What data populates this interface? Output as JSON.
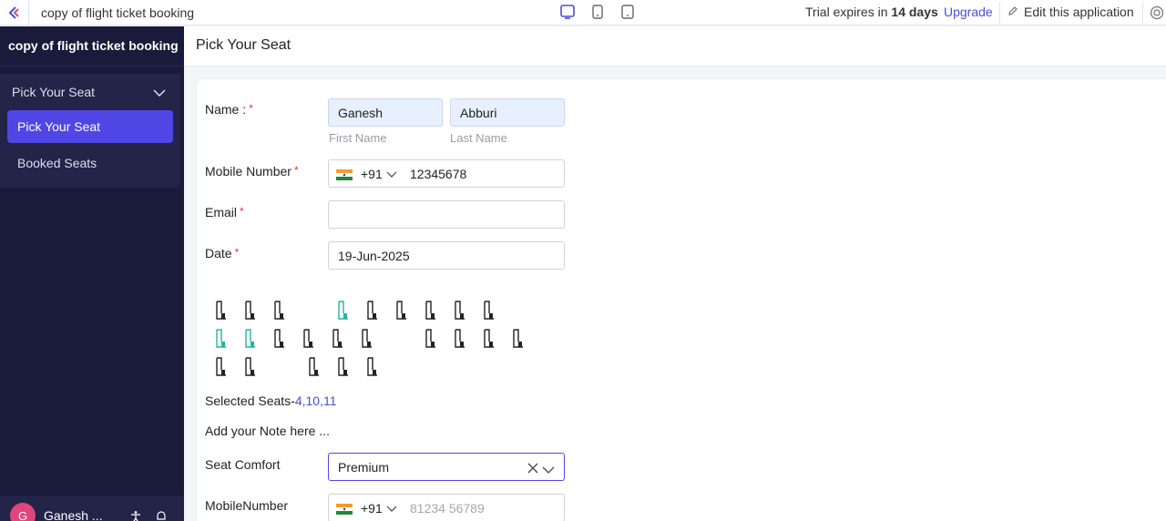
{
  "topbar": {
    "app_title": "copy of flight ticket booking",
    "trial_prefix": "Trial expires in ",
    "trial_days": "14 days",
    "upgrade": "Upgrade",
    "edit_app": "Edit this application"
  },
  "sidebar": {
    "brand": "copy of flight ticket booking",
    "group_label": "Pick Your Seat",
    "items": [
      {
        "label": "Pick Your Seat",
        "active": true
      },
      {
        "label": "Booked Seats",
        "active": false
      }
    ],
    "user": {
      "initial": "G",
      "name": "Ganesh ..."
    }
  },
  "page": {
    "title": "Pick Your Seat"
  },
  "form": {
    "name_label": "Name :",
    "first_name_value": "Ganesh",
    "last_name_value": "Abburi",
    "first_name_hint": "First Name",
    "last_name_hint": "Last Name",
    "mobile_label": "Mobile Number",
    "mobile_code": "+91",
    "mobile_value": "12345678",
    "email_label": "Email",
    "email_value": "",
    "date_label": "Date",
    "date_value": "19-Jun-2025",
    "required_mark": "*",
    "selected_seats_label": "Selected Seats-",
    "selected_seats_value": "4,10,11",
    "note_label": "Add your Note here ...",
    "seat_comfort_label": "Seat Comfort",
    "seat_comfort_value": "Premium",
    "mobile2_label": "MobileNumber",
    "mobile2_code": "+91",
    "mobile2_placeholder": "81234 56789"
  },
  "seat_map": {
    "rows": [
      [
        {
          "s": "a"
        },
        {
          "s": "a"
        },
        {
          "s": "a"
        },
        {
          "s": "gap"
        },
        {
          "s": "selected"
        },
        {
          "s": "a"
        },
        {
          "s": "a"
        },
        {
          "s": "a"
        },
        {
          "s": "a"
        },
        {
          "s": "a"
        }
      ],
      [
        {
          "s": "selected"
        },
        {
          "s": "selected"
        },
        {
          "s": "a"
        },
        {
          "s": "a"
        },
        {
          "s": "a"
        },
        {
          "s": "a"
        },
        {
          "s": "gap"
        },
        {
          "s": "a"
        },
        {
          "s": "a"
        },
        {
          "s": "a"
        },
        {
          "s": "a"
        }
      ],
      [
        {
          "s": "a"
        },
        {
          "s": "a"
        },
        {
          "s": "gap"
        },
        {
          "s": "a"
        },
        {
          "s": "a"
        },
        {
          "s": "a"
        }
      ]
    ],
    "colors": {
      "available": "#222222",
      "selected": "#26b3a0"
    }
  },
  "colors": {
    "accent": "#5046e5",
    "sidebar_bg": "#1a1a3a",
    "link": "#4a4fd8",
    "required": "#e53935"
  },
  "icons": [
    "app-logo-icon",
    "desktop-icon",
    "tablet-icon",
    "mobile-icon",
    "pencil-icon",
    "help-icon",
    "chevron-down-icon",
    "india-flag-icon",
    "clear-icon",
    "accessibility-icon",
    "bell-icon"
  ]
}
